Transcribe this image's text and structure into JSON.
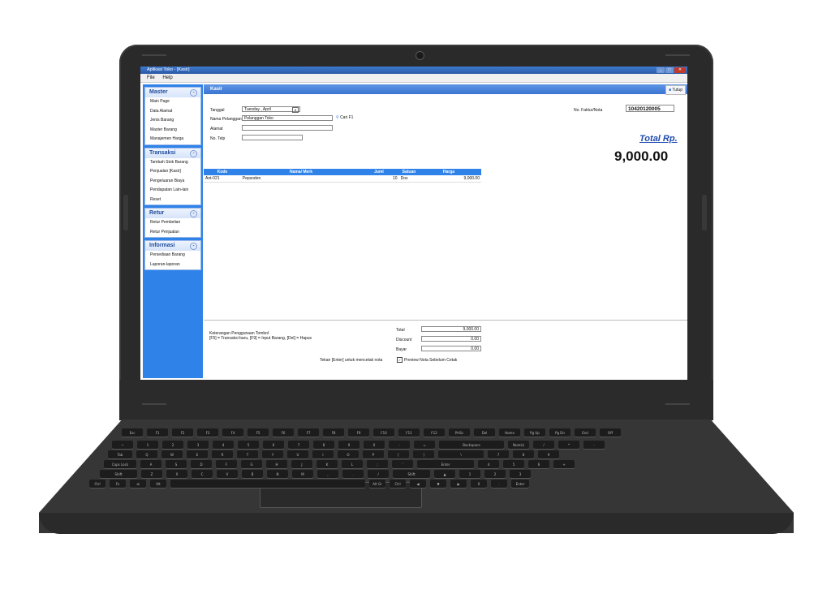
{
  "window": {
    "title": "Aplikasi Toko - [Kasir]",
    "menu": [
      "File",
      "Help"
    ]
  },
  "sidebar": {
    "groups": [
      {
        "title": "Master",
        "items": [
          "Main Page",
          "Data Alamat",
          "Jenis Barang",
          "Master Barang",
          "Manajemen Harga"
        ]
      },
      {
        "title": "Transaksi",
        "items": [
          "Tambah Stok Barang",
          "Penjualan [Kasir]",
          "Pengeluaran Biaya",
          "Pendapatan Lain-lain",
          "Reset"
        ]
      },
      {
        "title": "Retur",
        "items": [
          "Retur Pembelian",
          "Retur Penjualan"
        ]
      },
      {
        "title": "Informasi",
        "items": [
          "Persediaan Barang",
          "Laporan-laporan"
        ]
      }
    ]
  },
  "panel": {
    "title": "Kasir",
    "close_label": "Tutup"
  },
  "form": {
    "tanggal_label": "Tanggal",
    "tanggal_value": "Tuesday ,    April",
    "pelanggan_label": "Nama Pelanggan",
    "pelanggan_value": "Pelanggan Toko",
    "cari_label": "Cari F1",
    "alamat_label": "Alamat",
    "telp_label": "No. Telp",
    "faktur_label": "No. Faktur/Nota",
    "faktur_value": "10420120005",
    "total_label": "Total Rp.",
    "total_value": "9,000.00"
  },
  "grid": {
    "headers": [
      "Kode",
      "Nama/ Merk",
      "Juml",
      "Satuan",
      "Harga"
    ],
    "rows": [
      [
        "Ant-021",
        "Pepsoden",
        "10",
        "Dos",
        "9,000.00"
      ]
    ]
  },
  "footer": {
    "help_title": "Keterangan Penggunaan Tombol",
    "help_keys": "[F5] = Transaksi baru,  [F9] = Input Barang,  [Del] = Hapus",
    "enter_hint": "Tekan [Enter] untuk mencetak nota",
    "preview_label": "Preview Nota Sebelum Cetak",
    "total_label": "Total",
    "total_value": "9,000.00",
    "discount_label": "Discount",
    "discount_value": "0.00",
    "bayar_label": "Bayar",
    "bayar_value": "0.00"
  },
  "keyboard": {
    "row1": [
      "Esc",
      "F1",
      "F2",
      "F3",
      "F4",
      "F5",
      "F6",
      "F7",
      "F8",
      "F9",
      "F10",
      "F11",
      "F12",
      "PrtSc",
      "Del",
      "Home",
      "Pg Up",
      "Pg Dn",
      "End",
      "Off"
    ],
    "row2": [
      "~",
      "1",
      "2",
      "3",
      "4",
      "5",
      "6",
      "7",
      "8",
      "9",
      "0",
      "-",
      "=",
      "Backspace",
      "NumLk",
      "/",
      "*",
      "-"
    ],
    "row3": [
      "Tab",
      "Q",
      "W",
      "E",
      "R",
      "T",
      "Y",
      "U",
      "I",
      "O",
      "P",
      "[",
      "]",
      "\\",
      "7",
      "8",
      "9"
    ],
    "row4": [
      "Caps Lock",
      "A",
      "S",
      "D",
      "F",
      "G",
      "H",
      "J",
      "K",
      "L",
      ";",
      "'",
      "Enter",
      "4",
      "5",
      "6",
      "+"
    ],
    "row5": [
      "Shift",
      "Z",
      "X",
      "C",
      "V",
      "B",
      "N",
      "M",
      ",",
      ".",
      "/",
      "Shift",
      "▲",
      "1",
      "2",
      "3"
    ],
    "row6": [
      "Ctrl",
      "Fn",
      "⊞",
      "Alt",
      "",
      "Alt Gr",
      "Ctrl",
      "◀",
      "▼",
      "▶",
      "0",
      ".",
      "Enter"
    ]
  }
}
